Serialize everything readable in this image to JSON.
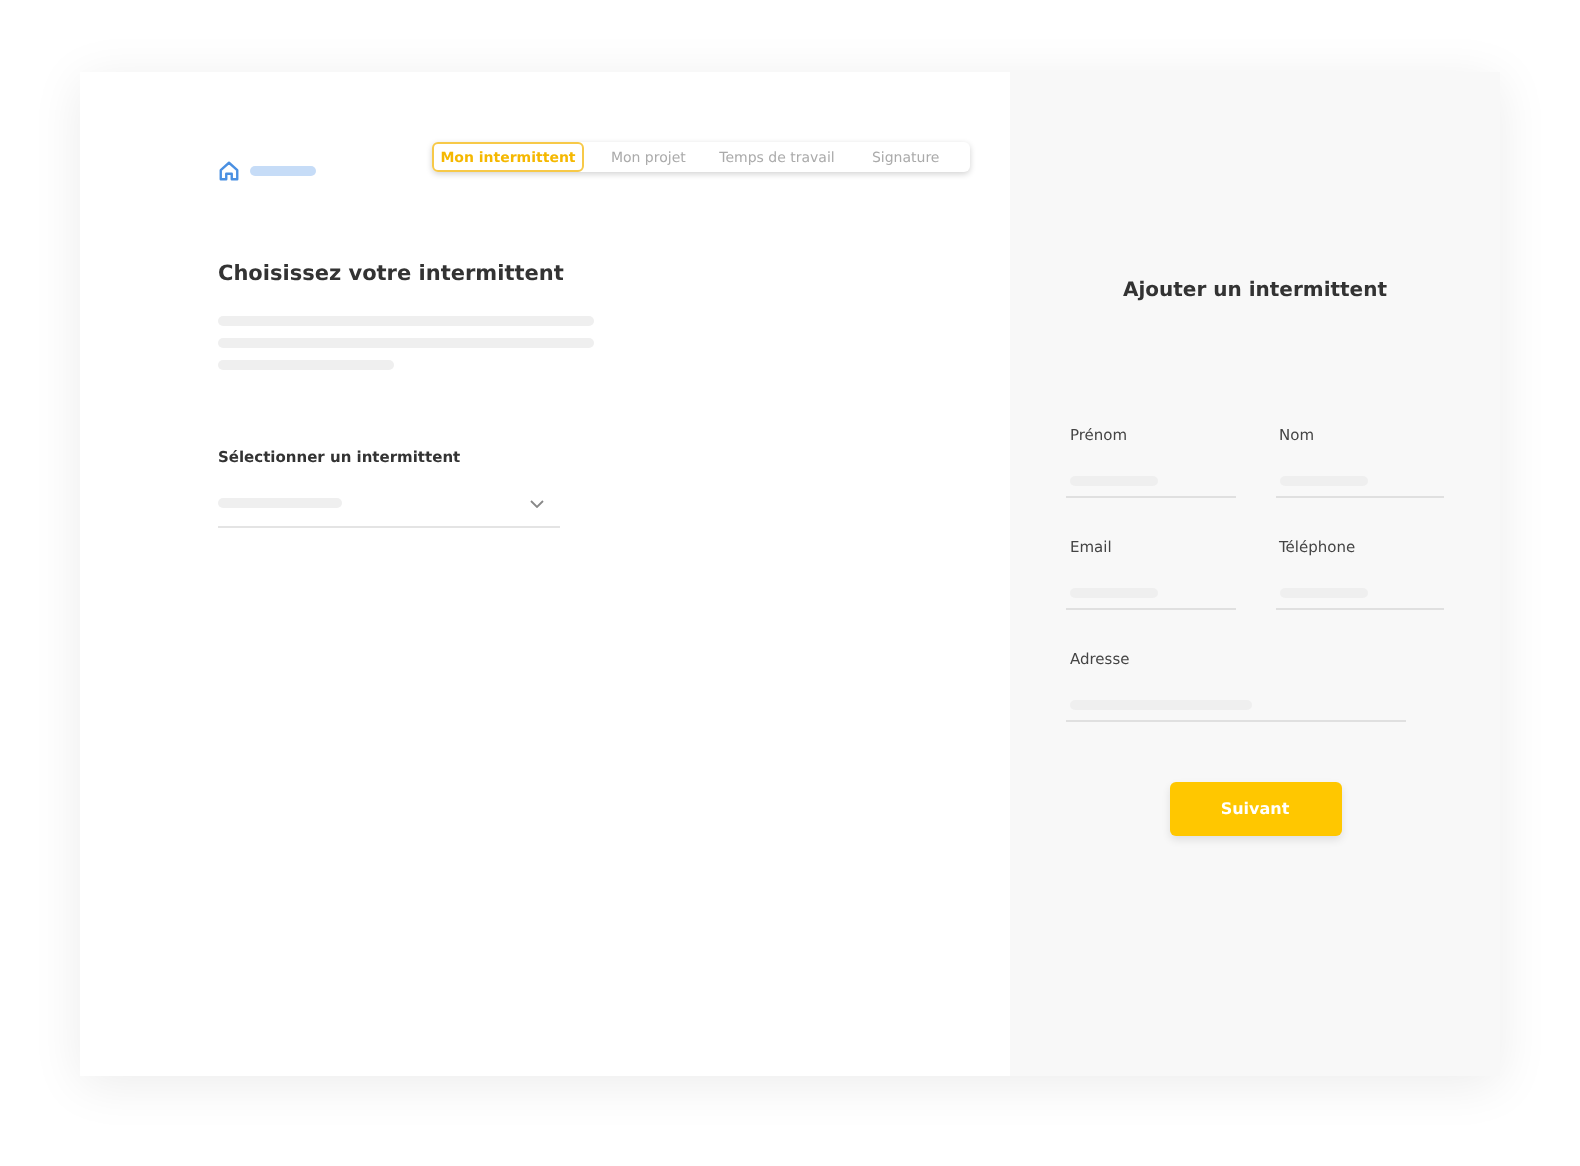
{
  "tabs": [
    {
      "label": "Mon intermittent",
      "selected": true
    },
    {
      "label": "Mon projet",
      "selected": false
    },
    {
      "label": "Temps de travail",
      "selected": false
    },
    {
      "label": "Signature",
      "selected": false
    }
  ],
  "main": {
    "title": "Choisissez votre intermittent",
    "select_label": "Sélectionner un intermittent"
  },
  "form": {
    "title": "Ajouter un intermittent",
    "rows": [
      [
        {
          "label": "Prénom"
        },
        {
          "label": "Nom"
        }
      ],
      [
        {
          "label": "Email"
        },
        {
          "label": "Téléphone"
        }
      ],
      [
        {
          "label": "Adresse"
        }
      ]
    ],
    "button": "Suivant"
  }
}
